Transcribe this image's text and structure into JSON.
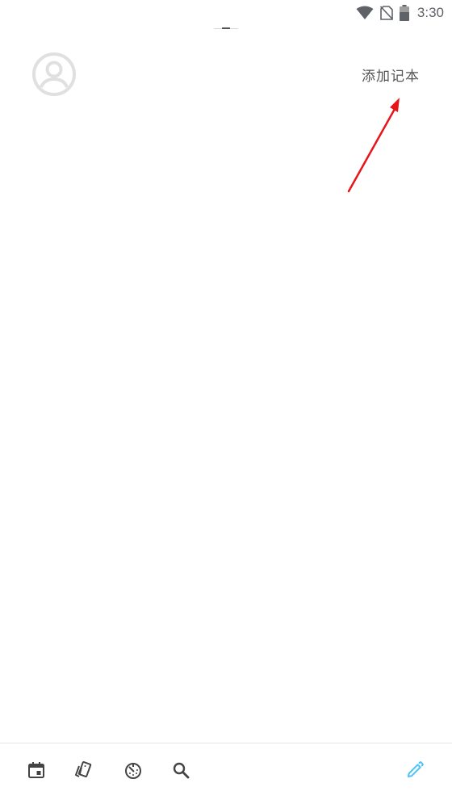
{
  "status_bar": {
    "time": "3:30",
    "icons": [
      "wifi-icon",
      "no-sim-icon",
      "battery-icon"
    ]
  },
  "header": {
    "avatar_icon": "account-circle-icon",
    "add_notebook_label": "添加记本"
  },
  "annotation": {
    "arrow_color": "#e8141a"
  },
  "toolbar": {
    "items": [
      {
        "name": "calendar-icon"
      },
      {
        "name": "cards-icon"
      },
      {
        "name": "timer-icon"
      },
      {
        "name": "search-icon"
      }
    ],
    "compose_icon": "edit-pencil-icon",
    "compose_color": "#4fc3f7"
  },
  "colors": {
    "icon_gray": "#444444",
    "avatar_gray": "#e0e0e0"
  }
}
